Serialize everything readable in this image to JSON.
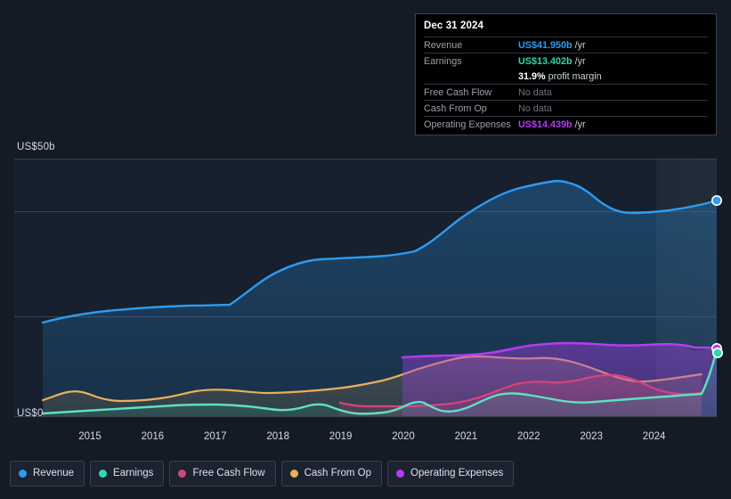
{
  "axis": {
    "y_top_label": "US$50b",
    "y_zero_label": "US$0",
    "x_ticks": [
      "2015",
      "2016",
      "2017",
      "2018",
      "2019",
      "2020",
      "2021",
      "2022",
      "2023",
      "2024"
    ]
  },
  "tooltip": {
    "date": "Dec 31 2024",
    "rows": [
      {
        "label": "Revenue",
        "value": "US$41.950b",
        "unit": "/yr",
        "color": "#2e9bf0",
        "nodata": false
      },
      {
        "label": "Earnings",
        "value": "US$13.402b",
        "unit": "/yr",
        "color": "#2fd9ac",
        "nodata": false
      },
      {
        "label": "",
        "value": "31.9%",
        "unit": "profit margin",
        "color": "#ffffff",
        "nodata": false
      },
      {
        "label": "Free Cash Flow",
        "value": "No data",
        "unit": "",
        "color": "#6d737c",
        "nodata": true
      },
      {
        "label": "Cash From Op",
        "value": "No data",
        "unit": "",
        "color": "#6d737c",
        "nodata": true
      },
      {
        "label": "Operating Expenses",
        "value": "US$14.439b",
        "unit": "/yr",
        "color": "#b53cf0",
        "nodata": false
      }
    ]
  },
  "legend": [
    {
      "label": "Revenue",
      "color": "#2e9bf0"
    },
    {
      "label": "Earnings",
      "color": "#2fd9ac"
    },
    {
      "label": "Free Cash Flow",
      "color": "#d6437e"
    },
    {
      "label": "Cash From Op",
      "color": "#e8b05c"
    },
    {
      "label": "Operating Expenses",
      "color": "#b53cf0"
    }
  ],
  "chart_data": {
    "type": "area",
    "title": "",
    "xlabel": "",
    "ylabel": "US$",
    "ylim": [
      0,
      50
    ],
    "xlim": [
      2014.3,
      2025.0
    ],
    "grid": true,
    "legend_position": "bottom-left",
    "units": "US$ billions per year",
    "gridlines_y": [
      0,
      12.5,
      32.5,
      50
    ],
    "annotations": [
      "Shaded band at right edge indicates forecast/estimate period"
    ],
    "series": [
      {
        "name": "Revenue",
        "color": "#2e9bf0",
        "x": [
          2014.35,
          2014.75,
          2015.0,
          2015.5,
          2016.0,
          2016.5,
          2017.0,
          2017.35,
          2017.75,
          2018.0,
          2018.5,
          2019.0,
          2019.5,
          2020.0,
          2020.4,
          2020.75,
          2021.0,
          2021.5,
          2021.9,
          2022.2,
          2022.5,
          2022.9,
          2023.3,
          2023.75,
          2024.25,
          2024.75,
          2025.0
        ],
        "y": [
          17.5,
          18.5,
          19.0,
          19.6,
          20.0,
          20.2,
          20.3,
          21.8,
          23.6,
          24.6,
          25.0,
          25.2,
          25.6,
          26.4,
          29.0,
          33.5,
          37.0,
          39.8,
          41.0,
          44.3,
          45.8,
          45.2,
          42.4,
          40.6,
          40.8,
          41.3,
          41.95
        ]
      },
      {
        "name": "Earnings",
        "color": "#2fd9ac",
        "x": [
          2014.35,
          2015.0,
          2015.6,
          2016.2,
          2016.8,
          2017.2,
          2017.6,
          2018.0,
          2018.4,
          2018.8,
          2019.1,
          2019.5,
          2019.9,
          2020.3,
          2020.7,
          2021.0,
          2021.4,
          2021.8,
          2022.1,
          2022.5,
          2022.9,
          2023.3,
          2023.7,
          2024.1,
          2024.5,
          2024.8,
          2025.0
        ],
        "y": [
          0.55,
          0.9,
          1.1,
          1.2,
          1.5,
          1.9,
          2.0,
          1.9,
          1.3,
          1.55,
          1.3,
          2.3,
          0.8,
          0.6,
          0.75,
          2.3,
          3.3,
          4.0,
          5.4,
          6.2,
          4.7,
          2.9,
          3.6,
          3.8,
          4.0,
          5.0,
          13.402
        ]
      },
      {
        "name": "Free Cash Flow",
        "color": "#d6437e",
        "x": [
          2018.85,
          2019.2,
          2019.6,
          2020.0,
          2020.5,
          2021.0,
          2021.4,
          2021.8,
          2022.1,
          2022.5,
          2022.9,
          2023.3,
          2023.7,
          2024.1,
          2024.5,
          2024.78
        ],
        "y": [
          3.0,
          2.6,
          2.6,
          2.8,
          3.0,
          4.4,
          6.3,
          6.8,
          6.4,
          7.2,
          6.6,
          4.6,
          3.3,
          4.2,
          4.3,
          4.6
        ]
      },
      {
        "name": "Cash From Op",
        "color": "#e8b05c",
        "x": [
          2014.35,
          2014.9,
          2015.3,
          2015.8,
          2016.3,
          2016.8,
          2017.2,
          2017.6,
          2018.0,
          2018.4,
          2018.8,
          2019.2,
          2019.6,
          2020.0,
          2020.5,
          2021.0,
          2021.4,
          2021.8,
          2022.1,
          2022.5,
          2022.9,
          2023.3,
          2023.7,
          2024.1,
          2024.5,
          2024.78
        ],
        "y": [
          3.0,
          3.4,
          4.0,
          3.5,
          3.3,
          3.3,
          4.0,
          4.5,
          4.7,
          4.3,
          4.6,
          4.8,
          4.6,
          4.9,
          5.6,
          7.4,
          8.4,
          8.0,
          8.6,
          9.2,
          8.3,
          6.3,
          6.2,
          6.4,
          7.0,
          7.6
        ]
      },
      {
        "name": "Operating Expenses",
        "color": "#b53cf0",
        "x": [
          2019.98,
          2020.4,
          2020.9,
          2021.3,
          2021.7,
          2022.1,
          2022.5,
          2022.9,
          2023.3,
          2023.7,
          2024.1,
          2024.5,
          2024.8,
          2025.0
        ],
        "y": [
          11.5,
          11.7,
          11.6,
          12.2,
          13.0,
          13.5,
          13.9,
          13.7,
          13.3,
          13.4,
          13.6,
          13.9,
          14.2,
          14.439
        ]
      }
    ],
    "endpoints": [
      {
        "series": "Revenue",
        "x": 2025.0,
        "y": 41.95
      },
      {
        "series": "Earnings",
        "x": 2025.0,
        "y": 13.402
      },
      {
        "series": "Operating Expenses",
        "x": 2025.0,
        "y": 14.439
      }
    ]
  }
}
